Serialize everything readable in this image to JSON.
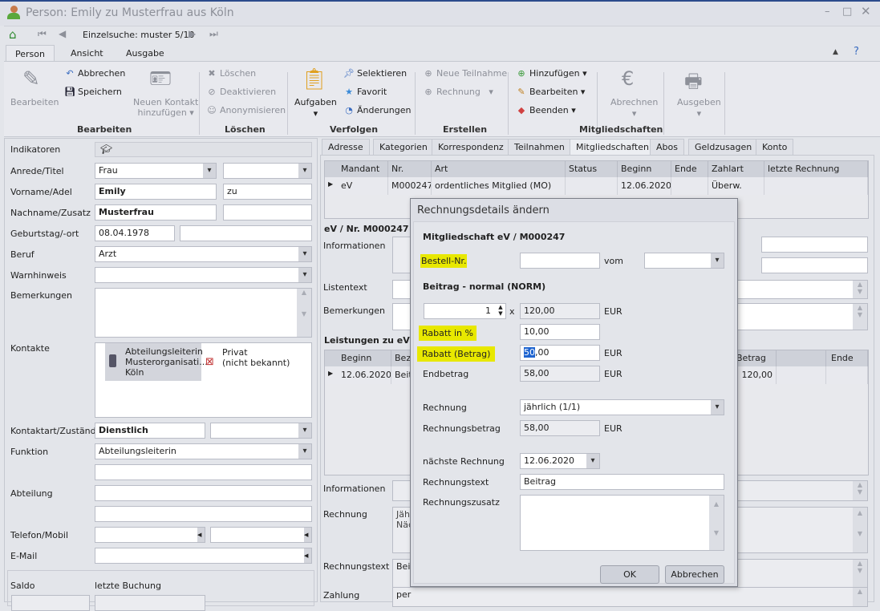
{
  "window": {
    "title": "Person: Emily zu Musterfrau aus Köln",
    "controls": [
      "minimize",
      "maximize",
      "close"
    ]
  },
  "nav": {
    "search_label": "Einzelsuche: muster 5/10"
  },
  "ribbon_tabs": [
    "Person",
    "Ansicht",
    "Ausgabe"
  ],
  "ribbon": {
    "bearbeiten": "Bearbeiten",
    "abbrechen": "Abbrechen",
    "speichern": "Speichern",
    "neuer_kontakt_1": "Neuen Kontakt",
    "neuer_kontakt_2": "hinzufügen",
    "group_bearbeiten": "Bearbeiten",
    "loeschen": "Löschen",
    "deaktivieren": "Deaktivieren",
    "anonymisieren": "Anonymisieren",
    "group_loeschen": "Löschen",
    "aufgaben": "Aufgaben",
    "selektieren": "Selektieren",
    "favorit": "Favorit",
    "aenderungen": "Änderungen",
    "group_verfolgen": "Verfolgen",
    "neue_teilnahme": "Neue Teilnahme",
    "rechnung": "Rechnung",
    "group_erstellen": "Erstellen",
    "hinzufuegen": "Hinzufügen",
    "bearbeiten2": "Bearbeiten",
    "beenden": "Beenden",
    "abrechnen": "Abrechnen",
    "ausgeben": "Ausgeben",
    "group_mitgliedschaften": "Mitgliedschaften"
  },
  "person": {
    "labels": {
      "indikatoren": "Indikatoren",
      "anrede": "Anrede/Titel",
      "vorname": "Vorname/Adel",
      "nachname": "Nachname/Zusatz",
      "geburtstag": "Geburtstag/-ort",
      "beruf": "Beruf",
      "warnhinweis": "Warnhinweis",
      "bemerkungen": "Bemerkungen",
      "kontakte": "Kontakte",
      "kontaktart": "Kontaktart/Zuständig",
      "funktion": "Funktion",
      "abteilung": "Abteilung",
      "telefon": "Telefon/Mobil",
      "email": "E-Mail",
      "saldo": "Saldo",
      "letzte_buchung": "letzte Buchung"
    },
    "anrede": "Frau",
    "titel": "",
    "vorname": "Emily",
    "adel": "zu",
    "nachname": "Musterfrau",
    "zusatz": "",
    "geburtstag": "08.04.1978",
    "geburtsort": "",
    "beruf": "Arzt",
    "warnhinweis": "",
    "bemerkungen": "",
    "kontakte": [
      {
        "lines": [
          "Abteilungsleiterin",
          "Musterorganisati...",
          "Köln"
        ]
      },
      {
        "lines": [
          "Privat",
          "(nicht bekannt)"
        ]
      }
    ],
    "kontaktart": "Dienstlich",
    "zustaendig": "",
    "funktion": "Abteilungsleiterin"
  },
  "detail_tabs": [
    "Adresse",
    "Kategorien",
    "Korrespondenz",
    "Teilnahmen",
    "Mitgliedschaften",
    "Abos",
    "Geldzusagen",
    "Konto"
  ],
  "active_detail_tab": "Mitgliedschaften",
  "memberships": {
    "columns": [
      "Mandant",
      "Nr.",
      "Art",
      "Status",
      "Beginn",
      "Ende",
      "Zahlart",
      "letzte Rechnung"
    ],
    "rows": [
      [
        "eV",
        "M000247",
        "ordentliches Mitglied (MO)",
        "",
        "12.06.2020",
        "",
        "Überw.",
        ""
      ]
    ],
    "section_title": "eV / Nr. M000247",
    "labels": {
      "informationen": "Informationen",
      "listentext": "Listentext",
      "bemerkungen": "Bemerkungen",
      "leistungen": "Leistungen zu eV /",
      "informationen2": "Informationen",
      "rechnung": "Rechnung",
      "rechnungstext": "Rechnungstext",
      "zahlung": "Zahlung"
    },
    "leistungen_columns": [
      "Beginn",
      "Bez",
      "Betrag",
      "",
      "Ende"
    ],
    "leistungen_rows": [
      [
        "12.06.2020",
        "Beit",
        "120,00",
        "",
        ""
      ]
    ],
    "rechnung_lines": [
      "Jähr",
      "Näc"
    ],
    "rechnungstext": "Beit",
    "zahlung": "per"
  },
  "dialog": {
    "title": "Rechnungsdetails ändern",
    "heading": "Mitgliedschaft eV / M000247",
    "bestell_label": "Bestell-Nr.",
    "bestell_value": "",
    "vom_label": "vom",
    "vom_value": "",
    "beitrag_heading": "Beitrag - normal (NORM)",
    "quantity": "1",
    "x": "x",
    "unit_price": "120,00",
    "currency": "EUR",
    "rabatt_pct_label": "Rabatt in %",
    "rabatt_pct": "10,00",
    "rabatt_betrag_label": "Rabatt (Betrag)",
    "rabatt_betrag_sel": "50",
    "rabatt_betrag_rest": ",00",
    "endbetrag_label": "Endbetrag",
    "endbetrag": "58,00",
    "rechnung_label": "Rechnung",
    "rechnung": "jährlich (1/1)",
    "rechnungsbetrag_label": "Rechnungsbetrag",
    "rechnungsbetrag": "58,00",
    "naechste_label": "nächste Rechnung",
    "naechste": "12.06.2020",
    "rechnungstext_label": "Rechnungstext",
    "rechnungstext": "Beitrag",
    "rechnungszusatz_label": "Rechnungszusatz",
    "rechnungszusatz": "",
    "ok": "OK",
    "cancel": "Abbrechen",
    "highlight_color": "#e8e800"
  }
}
